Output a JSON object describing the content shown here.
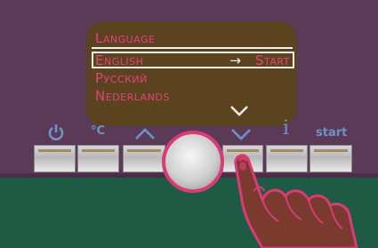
{
  "display": {
    "title": "Language",
    "selected_option": "English",
    "selected_arrow": "→",
    "selected_action": "Start",
    "options": [
      "Русский",
      "Nederlands"
    ]
  },
  "controls": {
    "power_icon": "power-icon",
    "temperature_label": "°C",
    "up_icon": "chevron-up-icon",
    "down_icon": "chevron-down-icon",
    "info_label": "i",
    "start_label": "start"
  },
  "colors": {
    "panel": "#5b3a58",
    "display_bg": "#5c4320",
    "menu_text": "#e8407a",
    "icon_blue": "#6b94c4",
    "counter": "#1f5a45",
    "knob_ring": "#d93b75"
  }
}
